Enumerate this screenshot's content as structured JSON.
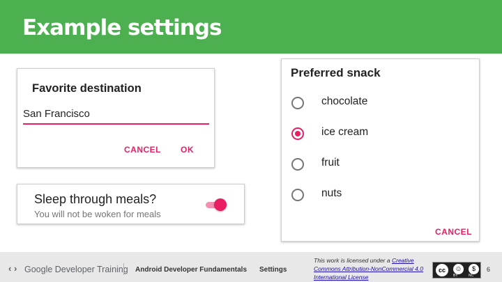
{
  "header": {
    "title": "Example settings"
  },
  "destination_dialog": {
    "title": "Favorite destination",
    "value": "San Francisco",
    "cancel_label": "CANCEL",
    "ok_label": "OK"
  },
  "sleep_setting": {
    "title": "Sleep through meals?",
    "summary": "You will not be woken for meals",
    "switch_on": true
  },
  "snack_dialog": {
    "title": "Preferred snack",
    "options": [
      {
        "label": "chocolate",
        "selected": false
      },
      {
        "label": "ice cream",
        "selected": true
      },
      {
        "label": "fruit",
        "selected": false
      },
      {
        "label": "nuts",
        "selected": false
      }
    ],
    "cancel_label": "CANCEL"
  },
  "footer": {
    "brand": "Google Developer Training",
    "course": "Android Developer Fundamentals",
    "lesson": "Settings",
    "license_prefix": "This work is licensed under a ",
    "license_link": "Creative Commons Attribution-NonCommercial 4.0 International License",
    "cc_by": "BY",
    "cc_nc": "NC",
    "page_number": "6"
  },
  "colors": {
    "header_green": "#4caf50",
    "accent_pink": "#e91e63"
  }
}
